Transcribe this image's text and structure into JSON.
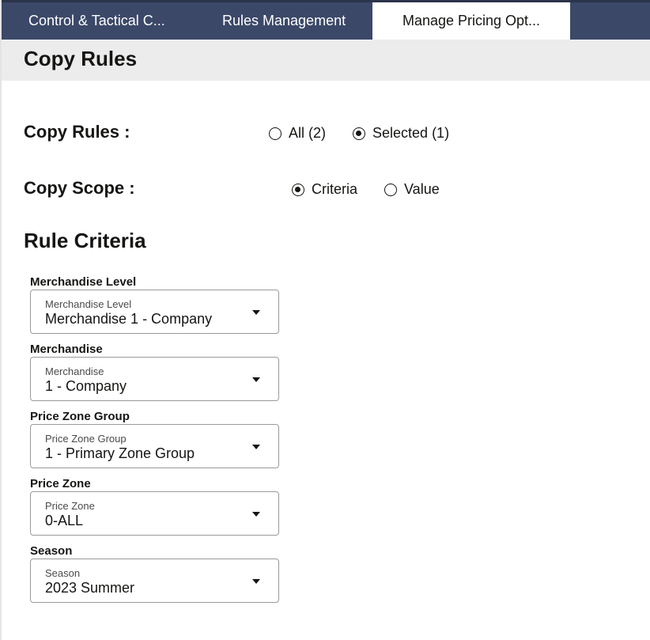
{
  "tabs": [
    {
      "label": "Control & Tactical C..."
    },
    {
      "label": "Rules Management"
    },
    {
      "label": "Manage Pricing Opt..."
    }
  ],
  "page_title": "Copy Rules",
  "copy_rules": {
    "label": "Copy Rules :",
    "options": [
      {
        "label": "All (2)",
        "selected": false
      },
      {
        "label": "Selected (1)",
        "selected": true
      }
    ]
  },
  "copy_scope": {
    "label": "Copy Scope :",
    "options": [
      {
        "label": "Criteria",
        "selected": true
      },
      {
        "label": "Value",
        "selected": false
      }
    ]
  },
  "rule_criteria": {
    "title": "Rule Criteria",
    "fields": [
      {
        "label": "Merchandise Level",
        "inner_label": "Merchandise Level",
        "value": "Merchandise 1 - Company"
      },
      {
        "label": "Merchandise",
        "inner_label": "Merchandise",
        "value": "1 - Company"
      },
      {
        "label": "Price Zone Group",
        "inner_label": "Price Zone Group",
        "value": "1 - Primary Zone Group"
      },
      {
        "label": "Price Zone",
        "inner_label": "Price Zone",
        "value": "0-ALL"
      },
      {
        "label": "Season",
        "inner_label": "Season",
        "value": "2023 Summer"
      }
    ]
  }
}
